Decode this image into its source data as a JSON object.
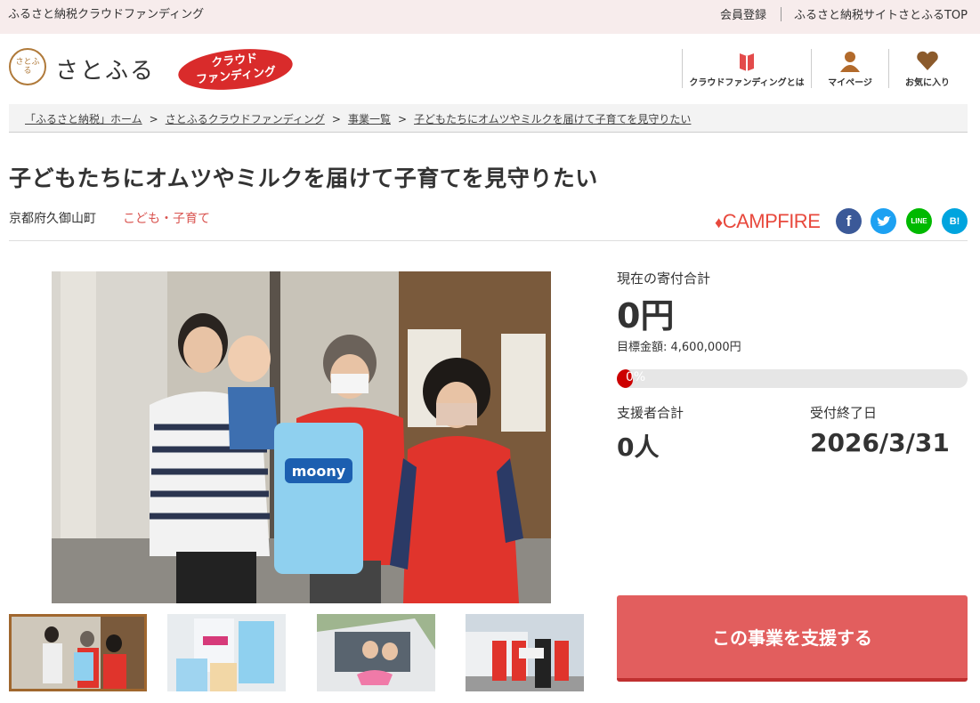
{
  "topbar": {
    "site_name": "ふるさと納税クラウドファンディング",
    "links": [
      "会員登録",
      "ふるさと納税サイトさとふるTOP"
    ]
  },
  "header": {
    "logo_text": "さとふる",
    "logo_mark": "さとふる",
    "badge_line1": "クラウド",
    "badge_line2": "ファンディング",
    "nav": [
      {
        "label": "クラウドファンディングとは",
        "icon": "book-icon"
      },
      {
        "label": "マイページ",
        "icon": "user-icon"
      },
      {
        "label": "お気に入り",
        "icon": "heart-icon"
      }
    ]
  },
  "breadcrumb": [
    "「ふるさと納税」ホーム",
    "さとふるクラウドファンディング",
    "事業一覧",
    "子どもたちにオムツやミルクを届けて子育てを見守りたい"
  ],
  "project": {
    "title": "子どもたちにオムツやミルクを届けて子育てを見守りたい",
    "location": "京都府久御山町",
    "category": "こども・子育て",
    "partner": "CAMPFIRE"
  },
  "sns": [
    {
      "name": "facebook",
      "glyph": "f",
      "color": "#3b5998"
    },
    {
      "name": "twitter",
      "glyph": "t",
      "color": "#1da1f2"
    },
    {
      "name": "line",
      "glyph": "LINE",
      "color": "#00b900"
    },
    {
      "name": "hatena",
      "glyph": "B!",
      "color": "#00a4de"
    }
  ],
  "stats": {
    "current_label": "現在の寄付合計",
    "current_value": "0円",
    "goal_text": "目標金額: 4,600,000円",
    "progress_percent": 0,
    "progress_label": "0%",
    "supporters_label": "支援者合計",
    "supporters_value": "0人",
    "deadline_label": "受付終了日",
    "deadline_value": "2026/3/31"
  },
  "support_button": "この事業を支援する"
}
